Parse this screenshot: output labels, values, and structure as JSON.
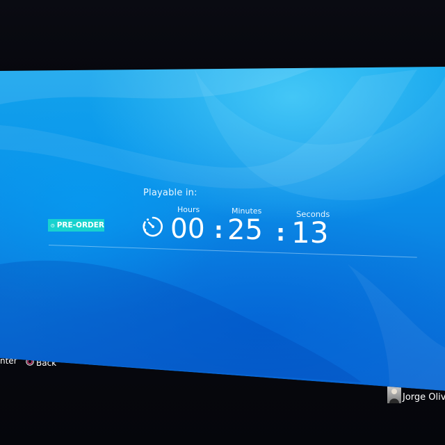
{
  "countdown": {
    "title": "Playable in:",
    "badge": "PRE-ORDER",
    "hours_label": "Hours",
    "minutes_label": "Minutes",
    "seconds_label": "Seconds",
    "hours": "00",
    "minutes": "25",
    "seconds": "13",
    "separator": ":"
  },
  "footer": {
    "enter_hint": "nter",
    "back_hint": "Back"
  },
  "user": {
    "name": "Jorge Oliv"
  },
  "icons": {
    "badge_icon": "clock-icon",
    "timer_icon": "stopwatch-icon",
    "back_button_icon": "circle-button-icon",
    "user_avatar": "avatar"
  },
  "colors": {
    "accent": "#18d2cf",
    "background": "#0b8ee8",
    "text": "#ffffff"
  }
}
